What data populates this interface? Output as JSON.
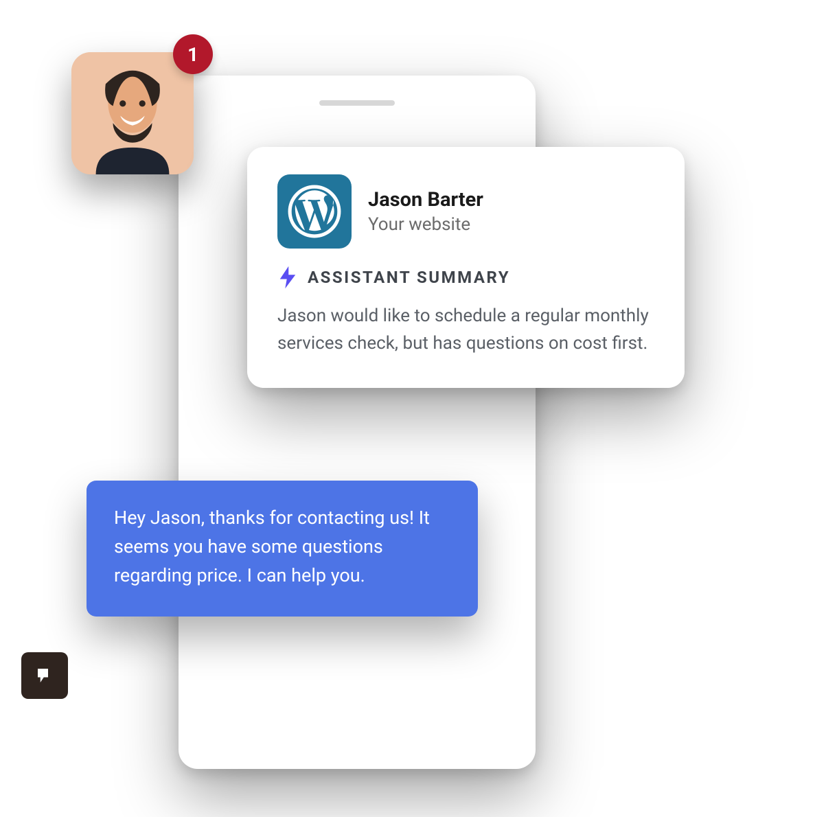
{
  "avatar": {
    "badge_count": "1"
  },
  "summary_card": {
    "contact_name": "Jason Barter",
    "contact_source": "Your website",
    "section_label": "ASSISTANT SUMMARY",
    "summary_text": "Jason would like to schedule a regular monthly services check, but has questions on cost first.",
    "source_icon": "wordpress-icon",
    "section_icon": "bolt-icon"
  },
  "reply": {
    "text": "Hey Jason, thanks for contacting us! It seems you have some questions regarding price. I can help you."
  },
  "colors": {
    "brand_blue": "#4d74e6",
    "badge_red": "#b2182b",
    "wordpress_teal": "#21759b",
    "bolt_purple": "#5a4ef2"
  }
}
